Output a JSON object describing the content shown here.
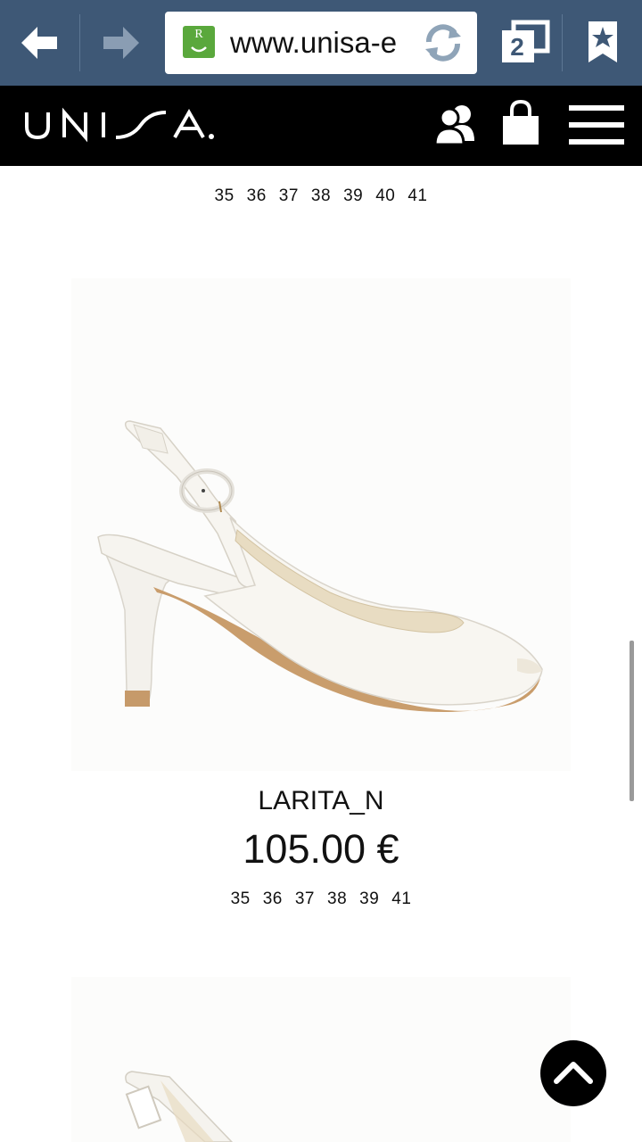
{
  "browser": {
    "url": "www.unisa-e",
    "tab_count": "2",
    "site_icon_letter": "R"
  },
  "header": {
    "logo": "UNISA"
  },
  "products": [
    {
      "sizes": [
        "35",
        "36",
        "37",
        "38",
        "39",
        "40",
        "41"
      ]
    },
    {
      "name": "LARITA_N",
      "price": "105.00 €",
      "sizes": [
        "35",
        "36",
        "37",
        "38",
        "39",
        "41"
      ]
    }
  ],
  "colors": {
    "browser_bar": "#3e5876",
    "header": "#000000",
    "site_icon": "#5aa83c"
  }
}
